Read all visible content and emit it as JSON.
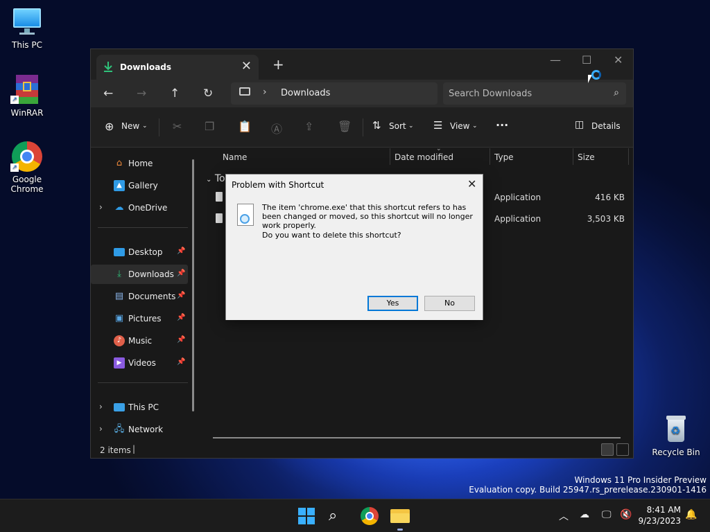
{
  "desktop": {
    "icons": [
      {
        "label": "This PC"
      },
      {
        "label": "WinRAR"
      },
      {
        "label": "Google Chrome"
      },
      {
        "label": "Recycle Bin"
      }
    ]
  },
  "explorer": {
    "tab_title": "Downloads",
    "address_crumb": "Downloads",
    "search_placeholder": "Search Downloads",
    "toolbar": {
      "new": "New",
      "sort": "Sort",
      "view": "View",
      "details": "Details"
    },
    "sidebar": {
      "items": [
        {
          "label": "Home"
        },
        {
          "label": "Gallery"
        },
        {
          "label": "OneDrive"
        },
        {
          "label": "Desktop"
        },
        {
          "label": "Downloads"
        },
        {
          "label": "Documents"
        },
        {
          "label": "Pictures"
        },
        {
          "label": "Music"
        },
        {
          "label": "Videos"
        },
        {
          "label": "This PC"
        },
        {
          "label": "Network"
        }
      ]
    },
    "columns": {
      "name": "Name",
      "date": "Date modified",
      "type": "Type",
      "size": "Size"
    },
    "group_label": "To",
    "files": [
      {
        "type": "Application",
        "size": "416 KB"
      },
      {
        "type": "Application",
        "size": "3,503 KB"
      }
    ],
    "status": {
      "count": "2 items",
      "cursor": "|"
    }
  },
  "dialog": {
    "title": "Problem with Shortcut",
    "message": "The item 'chrome.exe' that this shortcut refers to has been changed or moved, so this shortcut will no longer work properly.",
    "question": "Do you want to delete this shortcut?",
    "yes": "Yes",
    "no": "No"
  },
  "watermark": {
    "line1": "Windows 11 Pro Insider Preview",
    "line2": "Evaluation copy. Build 25947.rs_prerelease.230901-1416"
  },
  "clock": {
    "time": "8:41 AM",
    "date": "9/23/2023"
  }
}
